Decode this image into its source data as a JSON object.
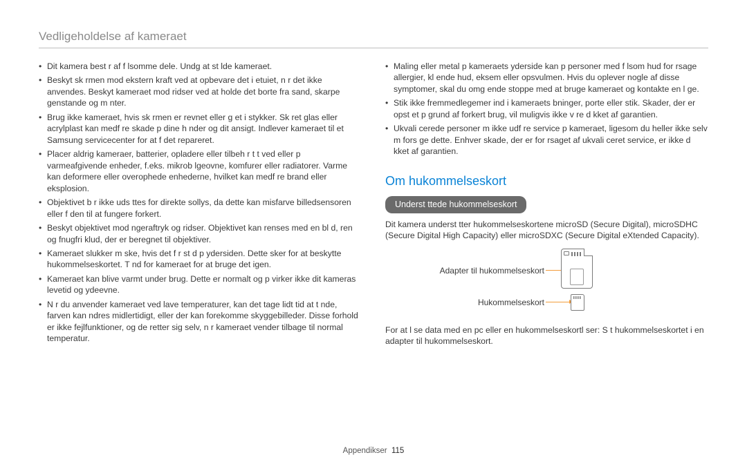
{
  "section_title": "Vedligeholdelse af kameraet",
  "left_bullets": [
    "Dit kamera best r af f lsomme dele. Undg  at st lde kameraet.",
    "Beskyt sk rmen mod ekstern kraft ved at opbevare det i etuiet, n r det ikke anvendes. Beskyt kameraet mod ridser ved at holde det borte fra sand, skarpe genstande og m nter.",
    "Brug ikke kameraet, hvis sk rmen er revnet eller g et i stykker. Sk ret glas eller acrylplast kan medf re skade p  dine h nder og dit ansigt. Indlever kameraet til et Samsung servicecenter for at f  det repareret.",
    "Placer aldrig kameraer, batterier, opladere eller tilbeh r t t ved eller p  varmeafgivende enheder, f.eks. mikrob lgeovne, komfurer eller radiatorer. Varme kan deformere eller overophede enhederne, hvilket kan medf re brand eller eksplosion.",
    "Objektivet b r ikke uds ttes for direkte sollys, da dette kan misfarve billedsensoren eller f  den til at fungere forkert.",
    "Beskyt objektivet mod  ngeraftryk og ridser. Objektivet kan renses med en bl d, ren og fnugfri klud, der er beregnet til objektiver.",
    "Kameraet slukker m ske, hvis det f r st d p  ydersiden. Dette sker for at beskytte hukommelseskortet. T nd for kameraet for at bruge det igen.",
    "Kameraet kan blive varmt under brug. Dette er normalt og p virker ikke dit kameras levetid og ydeevne.",
    "N r du anvender kameraet ved lave temperaturer, kan det tage lidt tid at t nde, farven kan  ndres midlertidigt, eller der kan forekomme skyggebilleder. Disse forhold er ikke fejlfunktioner, og de retter sig selv, n r kameraet vender tilbage til normal temperatur."
  ],
  "right_top_bullets": [
    "Maling eller metal p  kameraets yderside kan p  personer med f lsom hud for rsage allergier, kl ende hud, eksem eller opsvulmen. Hvis du oplever nogle af disse symptomer, skal du omg ende stoppe med at bruge kameraet og kontakte en l ge.",
    "Stik ikke fremmedlegemer ind i kameraets  bninger, porte eller stik. Skader, der er opst et p  grund af forkert brug, vil muligvis ikke v re d kket af garantien.",
    "Ukvali cerede personer m  ikke udf re service p  kameraet, ligesom du heller ikke selv m  fors ge dette. Enhver skade, der er for rsaget af ukvali ceret service, er ikke d kket af garantien."
  ],
  "heading_blue": "Om hukommelseskort",
  "pill_label": "Underst ttede hukommelseskort",
  "support_text": "Dit kamera underst tter hukommelseskortene microSD (Secure Digital), microSDHC (Secure Digital High Capacity) eller microSDXC (Secure Digital eXtended Capacity).",
  "diagram": {
    "label_a": "Adapter til hukommelseskort",
    "label_b": "Hukommelseskort"
  },
  "reader_text": "For at l se data med en pc eller en hukommelseskortl ser: S t hukommelseskortet i en adapter til hukommelseskort.",
  "footer": {
    "label": "Appendikser",
    "page": "115"
  }
}
